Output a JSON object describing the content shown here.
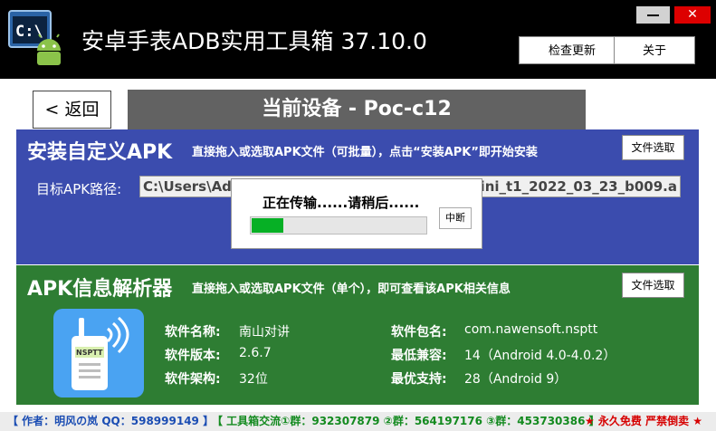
{
  "window": {
    "title": "安卓手表ADB实用工具箱  37.10.0",
    "icon": "terminal-android-icon",
    "minimize_icon": "minimize-icon",
    "close_label": "✕",
    "buttons": {
      "check_update": "检查更新",
      "about": "关于"
    }
  },
  "nav": {
    "back_label": "< 返回",
    "current_device": "当前设备 - Poc-c12"
  },
  "install": {
    "title": "安装自定义APK",
    "hint": "直接拖入或选取APK文件（可批量），点击“安装APK”即开始安装",
    "file_button": "文件选取",
    "path_label": "目标APK路径:",
    "path_value_visible_start": "C:\\Users\\Ad",
    "path_value_visible_end": "mini_t1_2022_03_23_b009.a",
    "colors": {
      "panel": "#3b4cae"
    }
  },
  "transfer_dialog": {
    "message": "正在传输......请稍后......",
    "progress": 0.18,
    "abort_button": "中断",
    "colors": {
      "progress_fill": "#06b025"
    }
  },
  "parser": {
    "title": "APK信息解析器",
    "hint": "直接拖入或选取APK文件（单个），即可查看该APK相关信息",
    "file_button": "文件选取",
    "app_icon": "walkie-talkie-icon",
    "app_icon_badge": "NSPTT",
    "fields": {
      "name_label": "软件名称:",
      "name_value": "南山对讲",
      "version_label": "软件版本:",
      "version_value": "2.6.7",
      "arch_label": "软件架构:",
      "arch_value": "32位",
      "package_label": "软件包名:",
      "package_value": "com.nawensoft.nsptt",
      "min_label": "最低兼容:",
      "min_value": "14（Android 4.0-4.0.2）",
      "target_label": "最优支持:",
      "target_value": "28（Android 9）"
    },
    "colors": {
      "panel": "#2e7d33"
    }
  },
  "footer": {
    "author": "【 作者：明风の岚  QQ：598999149 】",
    "groups": "【 工具箱交流①群：932307879 ②群：564197176 ③群：453730386 】",
    "free": "★ 永久免费 严禁倒卖 ★"
  }
}
